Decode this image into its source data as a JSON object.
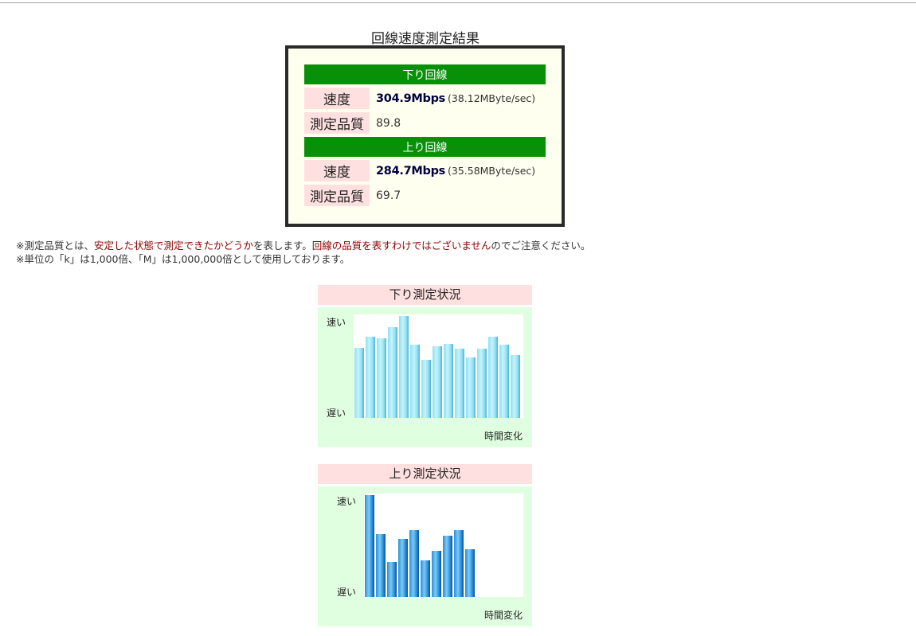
{
  "page": {
    "title": "回線速度測定結果"
  },
  "result": {
    "download": {
      "header": "下り回線",
      "speed_label": "速度",
      "speed_value": "304.9Mbps",
      "speed_sub": "(38.12MByte/sec)",
      "quality_label": "測定品質",
      "quality_value": "89.8"
    },
    "upload": {
      "header": "上り回線",
      "speed_label": "速度",
      "speed_value": "284.7Mbps",
      "speed_sub": "(35.58MByte/sec)",
      "quality_label": "測定品質",
      "quality_value": "69.7"
    }
  },
  "notes": {
    "line1_a": "※測定品質とは、",
    "line1_b": "安定した状態で測定できたかどうか",
    "line1_c": "を表します。",
    "line1_d": "回線の品質を表すわけではございません",
    "line1_e": "のでご注意ください。",
    "line2": "※単位の「k」は1,000倍、「M」は1,000,000倍として使用しております。"
  },
  "graphs": {
    "download": {
      "title": "下り測定状況",
      "fast_label": "速い",
      "slow_label": "遅い",
      "time_label": "時間変化"
    },
    "upload": {
      "title": "上り測定状況",
      "fast_label": "速い",
      "slow_label": "遅い",
      "time_label": "時間変化"
    }
  },
  "chart_data": [
    {
      "type": "bar",
      "ylim": [
        0,
        1
      ],
      "values": [
        0.69,
        0.8,
        0.78,
        0.89,
        1.0,
        0.72,
        0.57,
        0.7,
        0.73,
        0.68,
        0.59,
        0.68,
        0.8,
        0.72,
        0.62
      ],
      "color": "#8ee0f2"
    },
    {
      "type": "bar",
      "ylim": [
        0,
        1
      ],
      "values": [
        1.0,
        0.62,
        0.34,
        0.57,
        0.66,
        0.36,
        0.45,
        0.6,
        0.66,
        0.47
      ],
      "color": "#2a8fd8"
    }
  ]
}
